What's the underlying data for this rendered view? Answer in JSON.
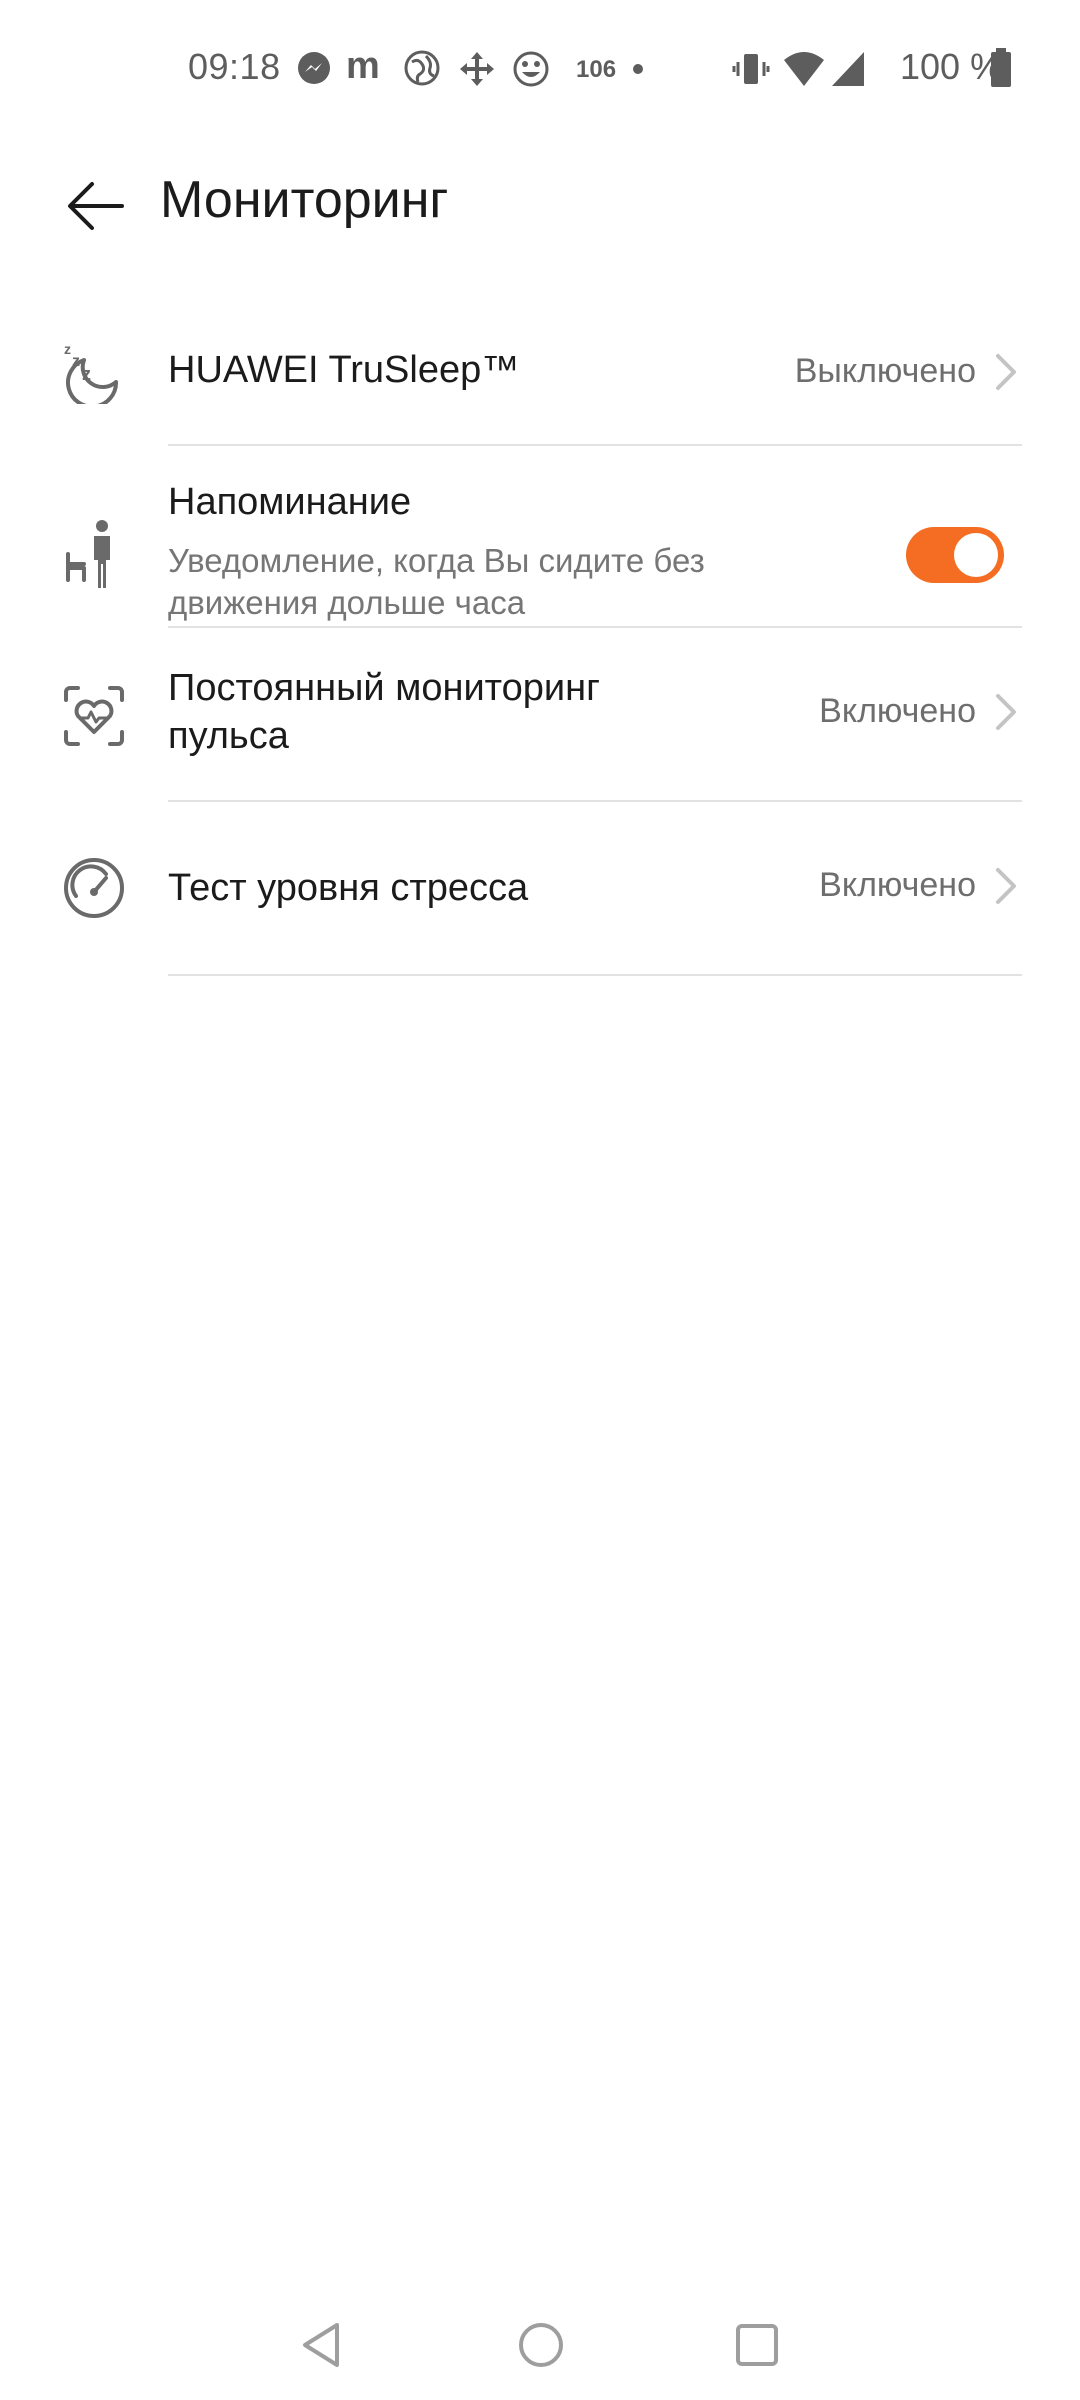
{
  "status_bar": {
    "time": "09:18",
    "notification_count": "106",
    "battery": "100 %",
    "icons": [
      "messenger-icon",
      "m-app-icon",
      "globe-icon",
      "move-icon",
      "emoji-icon",
      "dot-icon",
      "vibrate-icon",
      "wifi-icon",
      "signal-icon",
      "battery-icon"
    ]
  },
  "app_bar": {
    "title": "Мониторинг",
    "back_icon": "arrow-left-icon"
  },
  "settings": [
    {
      "id": "trusleep",
      "icon": "sleep-icon",
      "title": "HUAWEI TruSleep™",
      "value": "Выключено"
    },
    {
      "id": "reminder",
      "icon": "person-chair-icon",
      "title": "Напоминание",
      "subtitle": "Уведомление, когда Вы сидите без движения дольше часа",
      "toggle_on": true
    },
    {
      "id": "heart_rate",
      "icon": "heart-monitor-icon",
      "title": "Постоянный мониторинг пульса",
      "value": "Включено"
    },
    {
      "id": "stress",
      "icon": "gauge-icon",
      "title": "Тест уровня стресса",
      "value": "Включено"
    }
  ],
  "colors": {
    "accent": "#f46d22",
    "text_primary": "#1b1b1b",
    "text_secondary": "#767676",
    "divider": "#e2e2e2"
  },
  "nav_bar": {
    "icons": [
      "nav-back-icon",
      "nav-home-icon",
      "nav-recents-icon"
    ]
  }
}
